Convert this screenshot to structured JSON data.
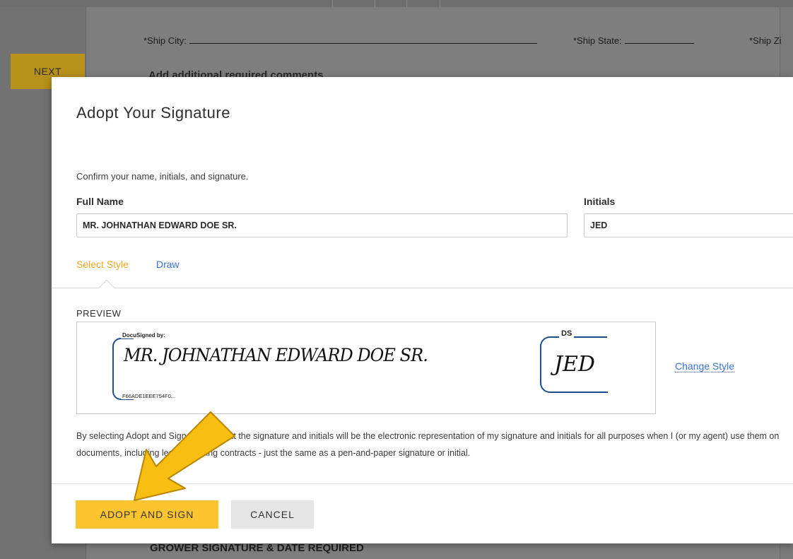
{
  "background": {
    "next_label": "NEXT",
    "ship_city_label": "*Ship City:",
    "ship_state_label": "*Ship State:",
    "ship_zip_label": "*Ship Zi",
    "section_heading": "Add additional required comments",
    "footer_heading": "GROWER SIGNATURE & DATE REQUIRED"
  },
  "modal": {
    "title": "Adopt Your Signature",
    "subtitle": "Confirm your name, initials, and signature.",
    "full_name_label": "Full Name",
    "full_name_value": "MR. JOHNATHAN EDWARD DOE SR.",
    "initials_label": "Initials",
    "initials_value": "JED",
    "tabs": [
      {
        "label": "Select Style",
        "active": true
      },
      {
        "label": "Draw",
        "active": false
      }
    ],
    "preview_label": "PREVIEW",
    "signature": {
      "header": "DocuSigned by:",
      "text": "MR. JOHNATHAN EDWARD DOE SR.",
      "footer": "F66ADE1EEE754F0..."
    },
    "initials_preview": {
      "header": "DS",
      "text": "JED"
    },
    "change_style_label": "Change Style",
    "legal_text": "By selecting Adopt and Sign, I agree that the signature and initials will be the electronic representation of my signature and initials for all purposes when I (or my agent) use them on documents, including legally binding contracts - just the same as a pen-and-paper signature or initial.",
    "adopt_button": "ADOPT AND SIGN",
    "cancel_button": "CANCEL"
  },
  "colors": {
    "accent_yellow": "#fcc530",
    "link_blue": "#3b73d8",
    "active_tab": "#f5a623",
    "signature_frame": "#1e4e8c",
    "arrow_fill": "#f8bf12"
  },
  "annotation": {
    "icon": "arrow-down-left-icon"
  }
}
